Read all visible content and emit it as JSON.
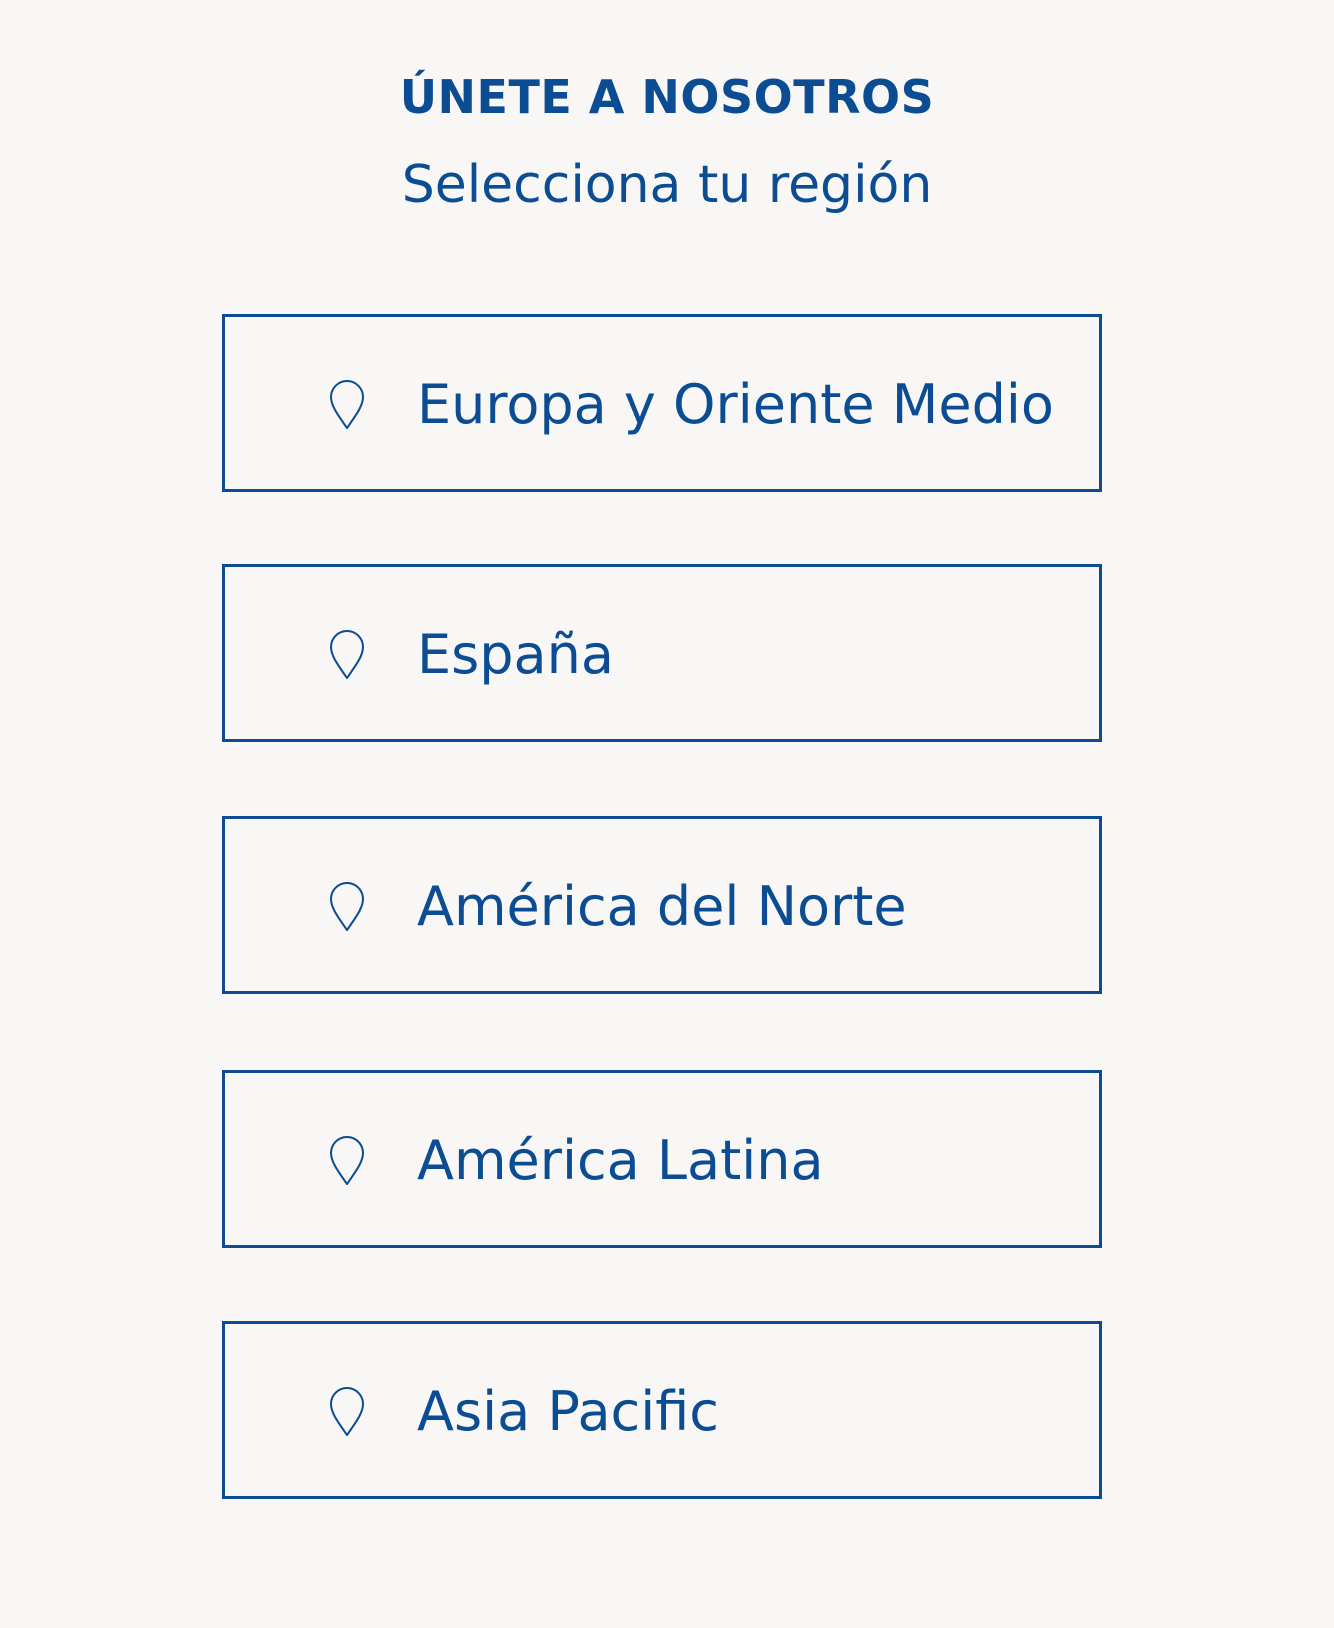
{
  "header": {
    "title": "ÚNETE A NOSOTROS",
    "subtitle": "Selecciona tu región"
  },
  "regions": [
    {
      "label": "Europa y Oriente Medio",
      "icon": "map-pin-icon"
    },
    {
      "label": "España",
      "icon": "map-pin-icon"
    },
    {
      "label": "América del Norte",
      "icon": "map-pin-icon"
    },
    {
      "label": "América Latina",
      "icon": "map-pin-icon"
    },
    {
      "label": "Asia Pacific",
      "icon": "map-pin-icon"
    }
  ],
  "colors": {
    "accent": "#0b4c92",
    "background": "#f8f7f5"
  }
}
